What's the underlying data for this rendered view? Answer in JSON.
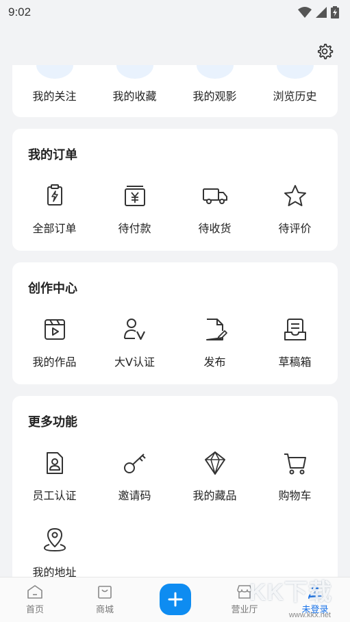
{
  "status_bar": {
    "time": "9:02"
  },
  "quick_links": [
    {
      "label": "我的关注",
      "icon": "follow-icon"
    },
    {
      "label": "我的收藏",
      "icon": "favorites-icon"
    },
    {
      "label": "我的观影",
      "icon": "watch-icon"
    },
    {
      "label": "浏览历史",
      "icon": "history-icon"
    }
  ],
  "orders": {
    "title": "我的订单",
    "items": [
      {
        "label": "全部订单",
        "icon": "clipboard-bolt-icon"
      },
      {
        "label": "待付款",
        "icon": "yen-wallet-icon"
      },
      {
        "label": "待收货",
        "icon": "truck-icon"
      },
      {
        "label": "待评价",
        "icon": "star-icon"
      }
    ]
  },
  "creation": {
    "title": "创作中心",
    "items": [
      {
        "label": "我的作品",
        "icon": "video-clapper-icon"
      },
      {
        "label": "大V认证",
        "icon": "user-v-icon"
      },
      {
        "label": "发布",
        "icon": "document-edit-icon"
      },
      {
        "label": "草稿箱",
        "icon": "drafts-box-icon"
      }
    ]
  },
  "more": {
    "title": "更多功能",
    "items": [
      {
        "label": "员工认证",
        "icon": "employee-badge-icon"
      },
      {
        "label": "邀请码",
        "icon": "key-icon"
      },
      {
        "label": "我的藏品",
        "icon": "diamond-icon"
      },
      {
        "label": "购物车",
        "icon": "cart-icon"
      },
      {
        "label": "我的地址",
        "icon": "location-pin-icon"
      }
    ]
  },
  "bottom_nav": {
    "items": [
      {
        "label": "首页",
        "icon": "home-icon"
      },
      {
        "label": "商城",
        "icon": "shopping-bag-icon"
      },
      {
        "label": "营业厅",
        "icon": "store-icon"
      },
      {
        "label": "未登录",
        "icon": "user-icon",
        "active": true
      }
    ],
    "center_icon": "plus-icon"
  },
  "watermark": {
    "text": "KK下载",
    "url": "www.kkx.net"
  },
  "colors": {
    "accent": "#0e8cf1",
    "active_tab": "#1a73e8",
    "background": "#f2f3f5"
  }
}
